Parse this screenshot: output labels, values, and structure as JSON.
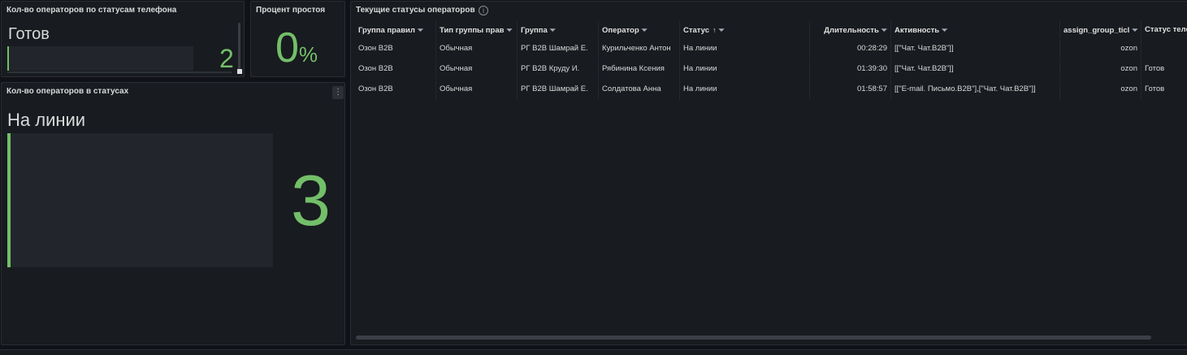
{
  "panel_phone": {
    "title": "Кол-во операторов по статусам телефона",
    "label": "Готов",
    "value": "2",
    "fill_fraction": 0.01
  },
  "panel_idle": {
    "title": "Процент простоя",
    "value": "0",
    "unit": "%"
  },
  "panel_status": {
    "title": "Кол-во операторов в статусах",
    "label": "На линии",
    "value": "3",
    "fill_fraction": 0.01,
    "menu_icon": "kebab-menu-icon"
  },
  "table": {
    "title": "Текущие статусы операторов",
    "info_icon": "info-icon",
    "headers": [
      "Группа правил",
      "Тип группы прав",
      "Группа",
      "Оператор",
      "Статус",
      "Длительность",
      "Активность",
      "assign_group_ticl",
      "Статус теле"
    ],
    "sort_indicator": "↑",
    "rows": [
      [
        "Озон B2B",
        "Обычная",
        "РГ B2B Шамрай Е.",
        "Курильченко Антон",
        "На линии",
        "00:28:29",
        "[[\"Чат. Чат.B2B\"]]",
        "ozon",
        ""
      ],
      [
        "Озон B2B",
        "Обычная",
        "РГ B2B Круду И.",
        "Рябинина Ксения",
        "На линии",
        "01:39:30",
        "[[\"Чат. Чат.B2B\"]]",
        "ozon",
        "Готов"
      ],
      [
        "Озон B2B",
        "Обычная",
        "РГ B2B Шамрай Е.",
        "Солдатова Анна",
        "На линии",
        "01:58:57",
        "[[\"E-mail. Письмо.B2B\"],[\"Чат. Чат.B2B\"]]",
        "ozon",
        "Готов"
      ]
    ]
  },
  "colors": {
    "accent_green": "#73bf69",
    "panel_bg": "#181b1f",
    "page_bg": "#111217"
  }
}
